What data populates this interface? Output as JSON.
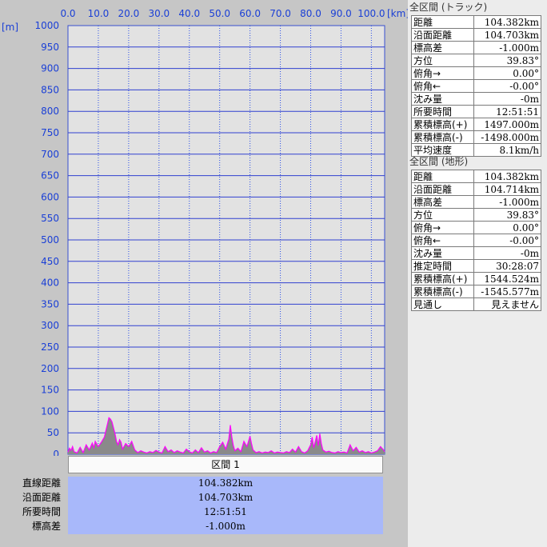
{
  "chart_data": {
    "type": "area",
    "xunit": "[km]",
    "yunit": "[m]",
    "xticks": [
      "0.0",
      "10.0",
      "20.0",
      "30.0",
      "40.0",
      "50.0",
      "60.0",
      "70.0",
      "80.0",
      "90.0",
      "100.0"
    ],
    "yticks": [
      "1000",
      "950",
      "900",
      "850",
      "800",
      "750",
      "700",
      "650",
      "600",
      "550",
      "500",
      "450",
      "400",
      "350",
      "300",
      "250",
      "200",
      "150",
      "100",
      "50",
      "0"
    ],
    "xlim": [
      0,
      104.382
    ],
    "ylim": [
      0,
      1000
    ],
    "grid": true,
    "series": [
      {
        "color": "#ff00ff",
        "fill": "#8a8a8a",
        "points": [
          [
            0,
            5
          ],
          [
            0.5,
            14
          ],
          [
            1,
            9
          ],
          [
            1.5,
            18
          ],
          [
            2,
            6
          ],
          [
            3,
            3
          ],
          [
            4,
            16
          ],
          [
            5,
            4
          ],
          [
            6,
            22
          ],
          [
            7,
            10
          ],
          [
            8,
            26
          ],
          [
            8.5,
            15
          ],
          [
            9,
            30
          ],
          [
            10,
            18
          ],
          [
            11,
            28
          ],
          [
            12,
            40
          ],
          [
            12.5,
            55
          ],
          [
            13,
            70
          ],
          [
            13.5,
            85
          ],
          [
            14,
            82
          ],
          [
            14.5,
            76
          ],
          [
            15,
            62
          ],
          [
            15.5,
            48
          ],
          [
            16,
            30
          ],
          [
            16.5,
            22
          ],
          [
            17,
            34
          ],
          [
            17.5,
            28
          ],
          [
            18,
            12
          ],
          [
            19,
            25
          ],
          [
            20,
            18
          ],
          [
            21,
            30
          ],
          [
            22,
            10
          ],
          [
            23,
            4
          ],
          [
            24,
            8
          ],
          [
            25,
            5
          ],
          [
            26,
            3
          ],
          [
            27,
            6
          ],
          [
            28,
            4
          ],
          [
            29,
            9
          ],
          [
            30,
            5
          ],
          [
            31,
            3
          ],
          [
            32,
            18
          ],
          [
            33,
            6
          ],
          [
            34,
            10
          ],
          [
            35,
            4
          ],
          [
            36,
            8
          ],
          [
            37,
            5
          ],
          [
            38,
            3
          ],
          [
            39,
            12
          ],
          [
            40,
            6
          ],
          [
            41,
            3
          ],
          [
            42,
            10
          ],
          [
            43,
            4
          ],
          [
            44,
            15
          ],
          [
            45,
            5
          ],
          [
            46,
            8
          ],
          [
            47,
            3
          ],
          [
            48,
            6
          ],
          [
            49,
            4
          ],
          [
            50,
            18
          ],
          [
            51,
            28
          ],
          [
            52,
            12
          ],
          [
            53,
            35
          ],
          [
            53.5,
            68
          ],
          [
            54,
            40
          ],
          [
            54.5,
            20
          ],
          [
            55,
            8
          ],
          [
            56,
            14
          ],
          [
            57,
            6
          ],
          [
            58,
            30
          ],
          [
            59,
            18
          ],
          [
            60,
            42
          ],
          [
            60.5,
            25
          ],
          [
            61,
            10
          ],
          [
            62,
            4
          ],
          [
            63,
            6
          ],
          [
            64,
            3
          ],
          [
            65,
            5
          ],
          [
            66,
            4
          ],
          [
            67,
            8
          ],
          [
            68,
            3
          ],
          [
            69,
            5
          ],
          [
            70,
            4
          ],
          [
            71,
            3
          ],
          [
            72,
            6
          ],
          [
            73,
            4
          ],
          [
            74,
            12
          ],
          [
            75,
            5
          ],
          [
            76,
            18
          ],
          [
            77,
            6
          ],
          [
            78,
            3
          ],
          [
            79,
            8
          ],
          [
            80,
            22
          ],
          [
            80.5,
            40
          ],
          [
            81,
            15
          ],
          [
            82,
            44
          ],
          [
            82.5,
            20
          ],
          [
            83,
            48
          ],
          [
            83.5,
            25
          ],
          [
            84,
            10
          ],
          [
            85,
            5
          ],
          [
            86,
            7
          ],
          [
            87,
            4
          ],
          [
            88,
            3
          ],
          [
            89,
            6
          ],
          [
            90,
            4
          ],
          [
            91,
            5
          ],
          [
            92,
            3
          ],
          [
            93,
            22
          ],
          [
            94,
            8
          ],
          [
            95,
            16
          ],
          [
            96,
            5
          ],
          [
            97,
            8
          ],
          [
            98,
            4
          ],
          [
            99,
            6
          ],
          [
            100,
            3
          ],
          [
            101,
            5
          ],
          [
            102,
            8
          ],
          [
            103,
            18
          ],
          [
            104,
            10
          ],
          [
            104.382,
            6
          ]
        ]
      }
    ]
  },
  "segment": {
    "header": "区間 1",
    "rows": [
      {
        "label": "直線距離",
        "value": "104.382km"
      },
      {
        "label": "沿面距離",
        "value": "104.703km"
      },
      {
        "label": "所要時間",
        "value": "12:51:51"
      },
      {
        "label": "標高差",
        "value": "-1.000m"
      }
    ]
  },
  "track": {
    "title": "全区間 (トラック)",
    "rows": [
      {
        "label": "距離",
        "value": "104.382km"
      },
      {
        "label": "沿面距離",
        "value": "104.703km"
      },
      {
        "label": "標高差",
        "value": "-1.000m"
      },
      {
        "label": "方位",
        "value": "39.83°"
      },
      {
        "label": "俯角→",
        "value": "0.00°"
      },
      {
        "label": "俯角←",
        "value": "-0.00°"
      },
      {
        "label": "沈み量",
        "value": "-0m"
      },
      {
        "label": "所要時間",
        "value": "12:51:51"
      },
      {
        "label": "累積標高(+)",
        "value": "1497.000m"
      },
      {
        "label": "累積標高(-)",
        "value": "-1498.000m"
      },
      {
        "label": "平均速度",
        "value": "8.1km/h"
      }
    ]
  },
  "terrain": {
    "title": "全区間 (地形)",
    "rows": [
      {
        "label": "距離",
        "value": "104.382km"
      },
      {
        "label": "沿面距離",
        "value": "104.714km"
      },
      {
        "label": "標高差",
        "value": "-1.000m"
      },
      {
        "label": "方位",
        "value": "39.83°"
      },
      {
        "label": "俯角→",
        "value": "0.00°"
      },
      {
        "label": "俯角←",
        "value": "-0.00°"
      },
      {
        "label": "沈み量",
        "value": "-0m"
      },
      {
        "label": "推定時間",
        "value": "30:28:07"
      },
      {
        "label": "累積標高(+)",
        "value": "1544.524m"
      },
      {
        "label": "累積標高(-)",
        "value": "-1545.577m"
      },
      {
        "label": "見通し",
        "value": "見えません"
      }
    ]
  }
}
